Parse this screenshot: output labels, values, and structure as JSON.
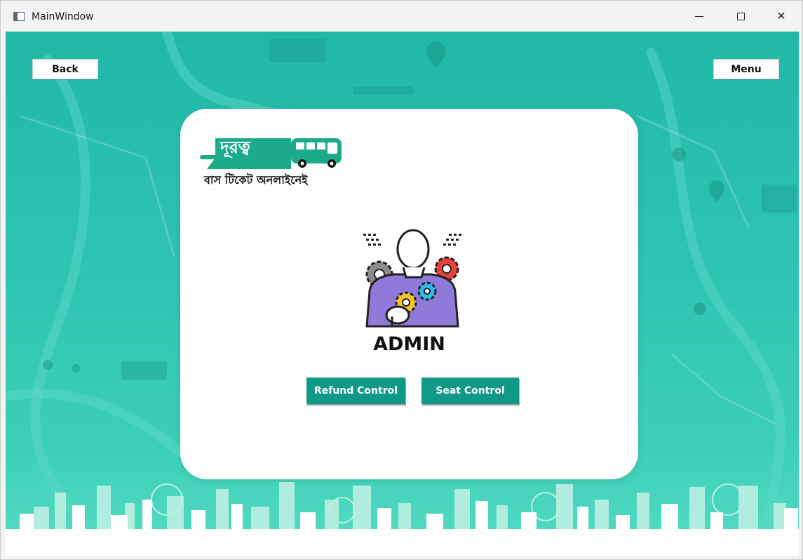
{
  "window": {
    "title": "MainWindow",
    "controls": [
      "minimize",
      "maximize",
      "close"
    ]
  },
  "nav": {
    "back_label": "Back",
    "menu_label": "Menu"
  },
  "card": {
    "brand_name": "দূরত্ব",
    "tagline": "বাস টিকেট অনলাইনেই",
    "heading": "ADMIN",
    "refund_label": "Refund Control",
    "seat_label": "Seat Control"
  },
  "colors": {
    "background_teal": "#2dc4b0",
    "brand_green": "#1bab8a",
    "button_teal": "#0f9986",
    "illustration_purple": "#8f7ad9",
    "gear_red": "#e8413c",
    "gear_yellow": "#f5c42a",
    "gear_blue": "#2fb8e8"
  },
  "icons": [
    "app-window-icon",
    "admin-gears-icon",
    "bus-icon"
  ]
}
